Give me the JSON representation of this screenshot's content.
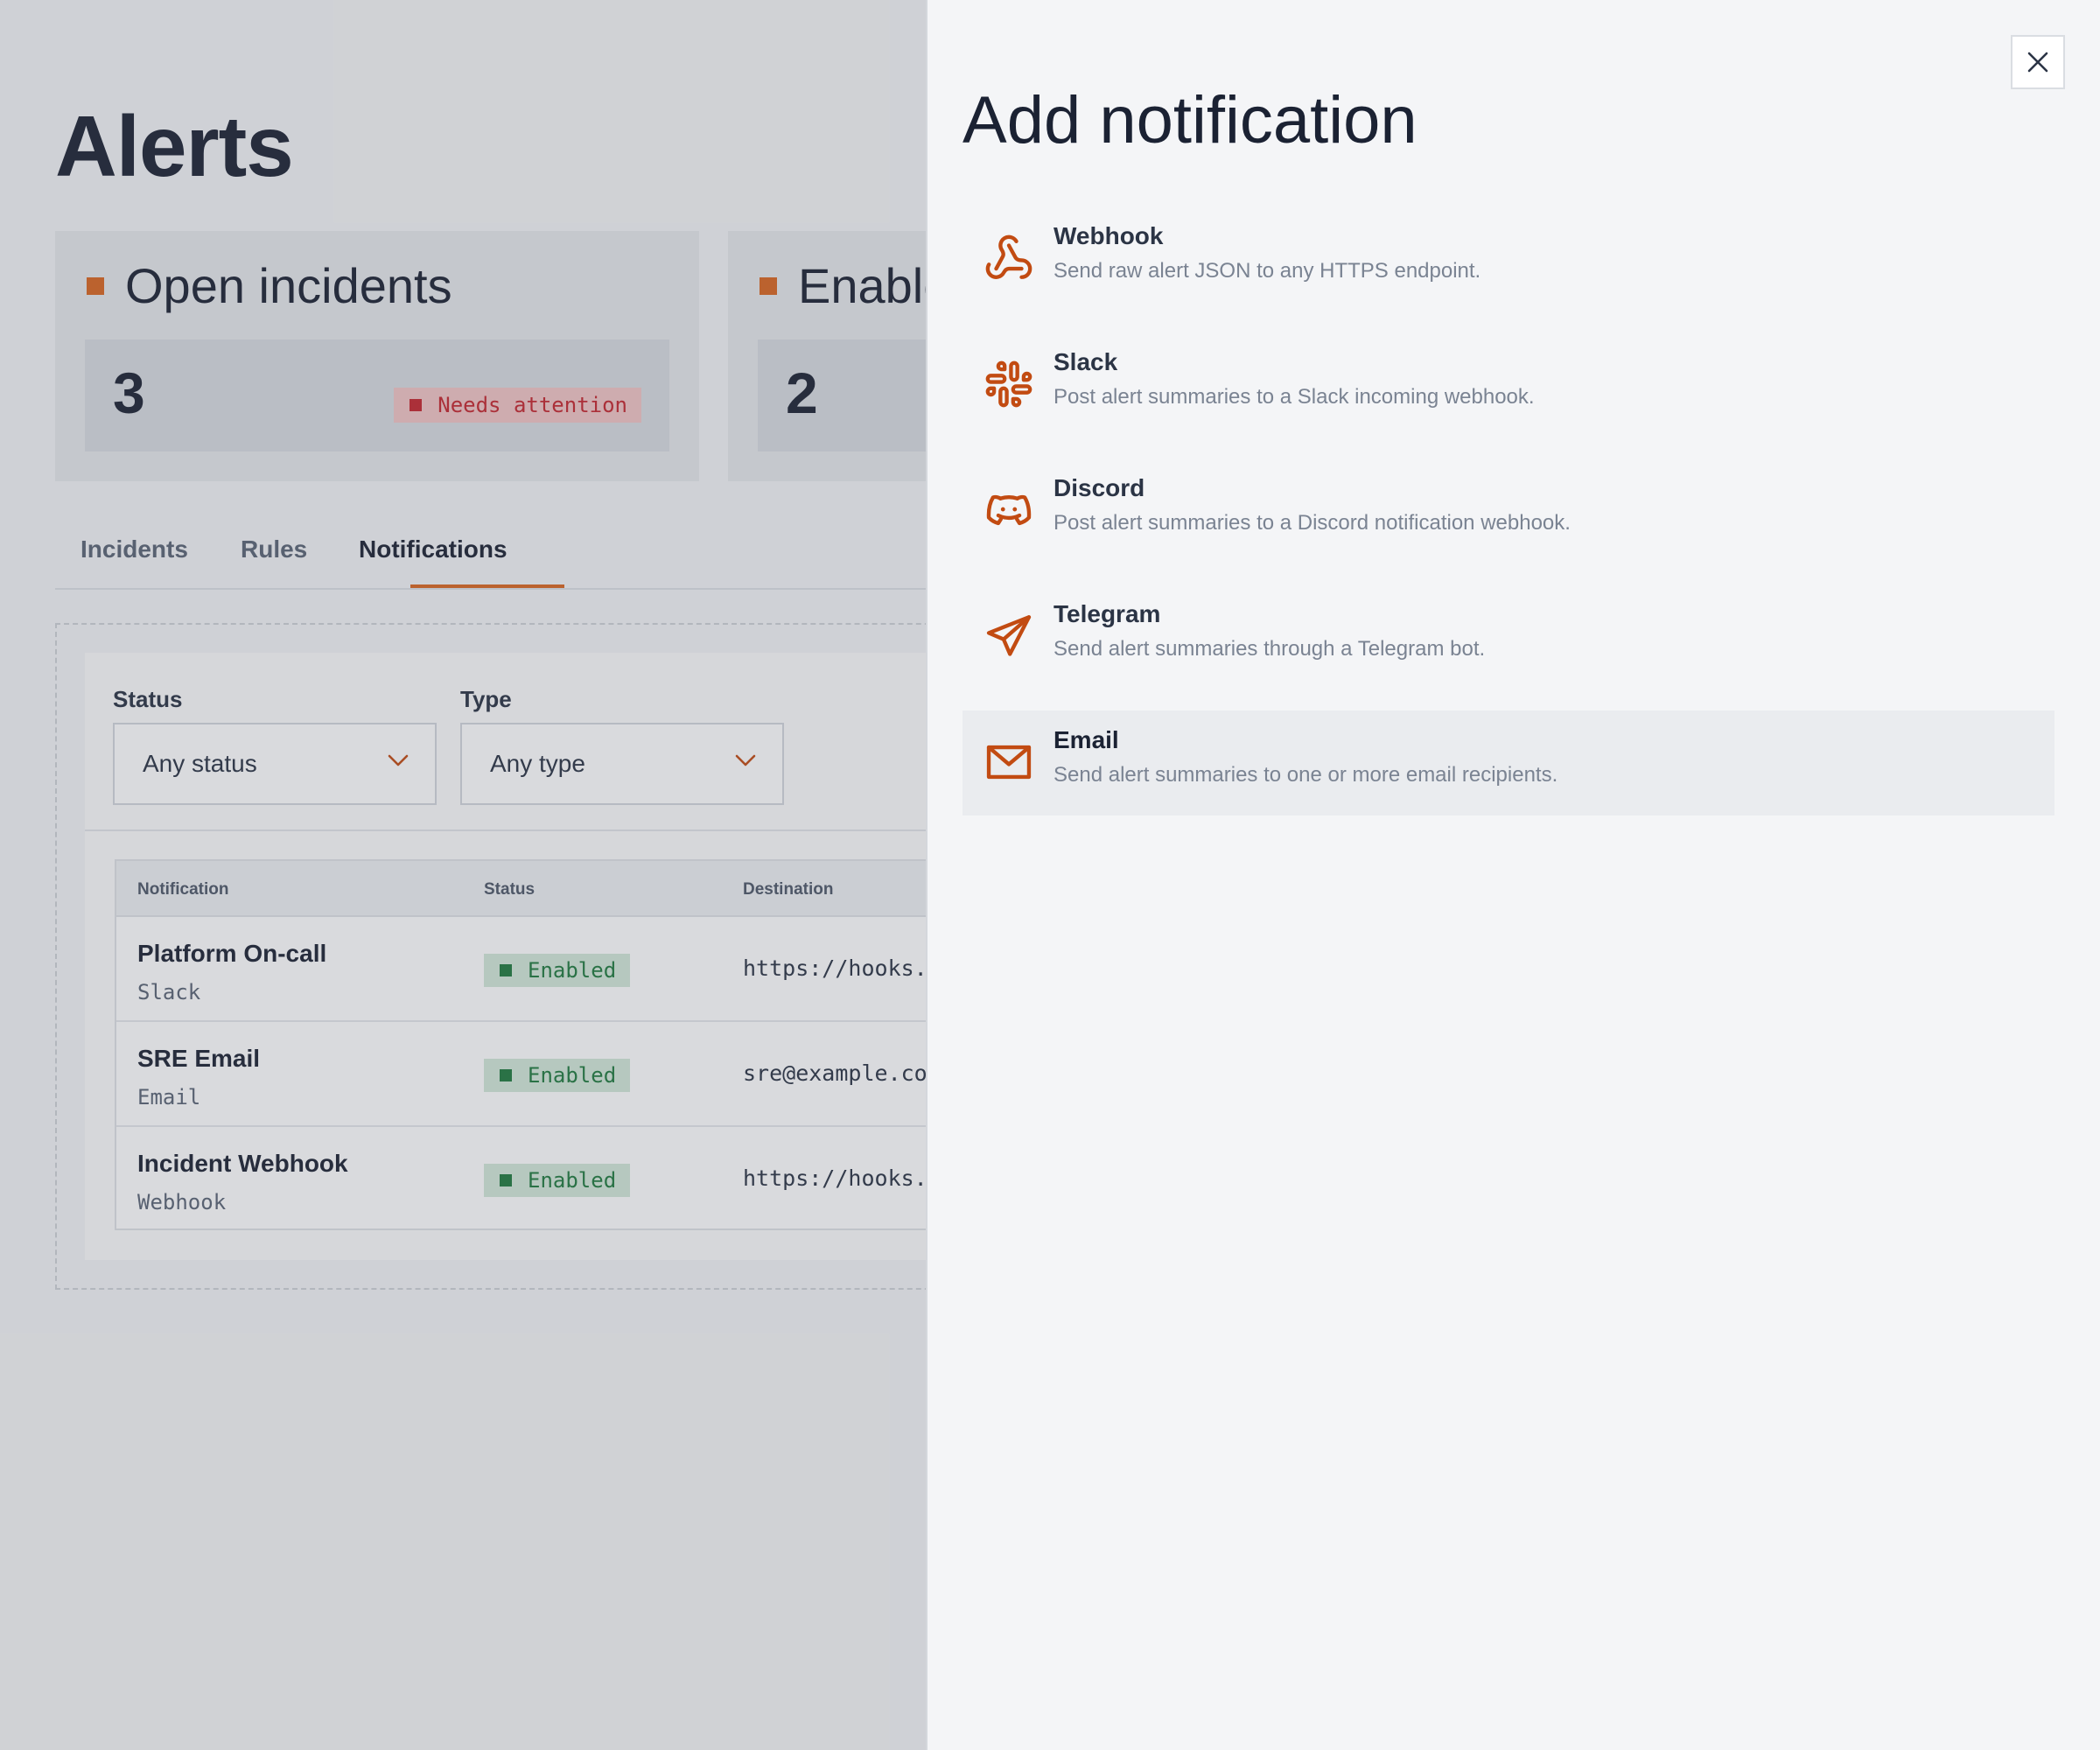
{
  "page": {
    "title": "Alerts",
    "stats": [
      {
        "label": "Open incidents",
        "value": "3",
        "badge": "Needs attention"
      },
      {
        "label": "Enabled",
        "value": "2"
      }
    ],
    "tabs": [
      "Incidents",
      "Rules",
      "Notifications"
    ],
    "active_tab": "Notifications",
    "filters": {
      "status_label": "Status",
      "status_value": "Any status",
      "type_label": "Type",
      "type_value": "Any type"
    },
    "table": {
      "headers": [
        "Notification",
        "Status",
        "Destination"
      ],
      "rows": [
        {
          "name": "Platform On-call",
          "type": "Slack",
          "status": "Enabled",
          "destination": "https://hooks."
        },
        {
          "name": "SRE Email",
          "type": "Email",
          "status": "Enabled",
          "destination": "sre@example.co"
        },
        {
          "name": "Incident Webhook",
          "type": "Webhook",
          "status": "Enabled",
          "destination": "https://hooks."
        }
      ]
    }
  },
  "drawer": {
    "title": "Add notification",
    "options": [
      {
        "name": "Webhook",
        "description": "Send raw alert JSON to any HTTPS endpoint.",
        "icon": "webhook-icon"
      },
      {
        "name": "Slack",
        "description": "Post alert summaries to a Slack incoming webhook.",
        "icon": "slack-icon"
      },
      {
        "name": "Discord",
        "description": "Post alert summaries to a Discord notification webhook.",
        "icon": "discord-icon"
      },
      {
        "name": "Telegram",
        "description": "Send alert summaries through a Telegram bot.",
        "icon": "telegram-icon"
      },
      {
        "name": "Email",
        "description": "Send alert summaries to one or more email recipients.",
        "icon": "mail-icon"
      }
    ]
  },
  "colors": {
    "accent": "#d9661f",
    "icon": "#c24b12",
    "danger": "#c4262e",
    "success": "#1f7a3e",
    "text": "#1b2233"
  }
}
